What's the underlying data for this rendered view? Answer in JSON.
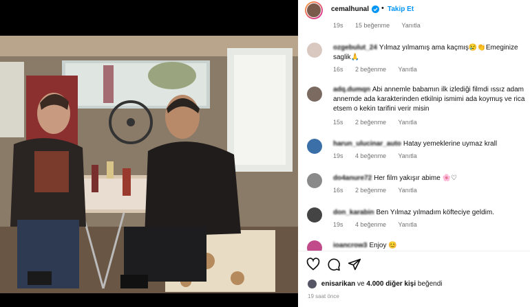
{
  "post": {
    "username": "cemalhunal",
    "follow_label": "Takip Et",
    "separator": "•"
  },
  "comments": [
    {
      "user": "",
      "text": "",
      "time": "19s",
      "likes": "15 beğenme",
      "reply": "Yanıtla"
    },
    {
      "user": "ozgebulut_24",
      "text": "Yılmaz yılmamış ama kaçmış😢👏Emeginize saglik🙏",
      "time": "16s",
      "likes": "2 beğenme",
      "reply": "Yanıtla"
    },
    {
      "user": "adq.dumqn",
      "text": "Abi annemle babamın ilk izlediği filmdi ıssız adam annemde ada karakterinden etkilnip ismimi ada koymuş ve rica etsem o kekin tarifini verir misin",
      "time": "15s",
      "likes": "2 beğenme",
      "reply": "Yanıtla"
    },
    {
      "user": "harun_ulucinar_auto",
      "text": "Hatay yemeklerine uymaz krall",
      "time": "19s",
      "likes": "4 beğenme",
      "reply": "Yanıtla"
    },
    {
      "user": "do4anure72",
      "text": "Her film yakışır abime 🌸♡",
      "time": "16s",
      "likes": "2 beğenme",
      "reply": "Yanıtla"
    },
    {
      "user": "don_karabin",
      "text": "Ben Yılmaz yılmadım köfteciye geldim.",
      "time": "19s",
      "likes": "4 beğenme",
      "reply": "Yanıtla"
    },
    {
      "user": "ioancrow3",
      "text": "Enjoy 😊",
      "time": "",
      "likes": "",
      "reply": ""
    }
  ],
  "likes": {
    "user": "enisarikan",
    "connector": "ve",
    "count_text": "4.000 diğer kişi",
    "suffix": "beğendi"
  },
  "time_ago": "19 saat önce",
  "icons": [
    "heart-icon",
    "comment-icon",
    "share-icon",
    "verified-icon"
  ],
  "colors": {
    "follow": "#0095f6",
    "verified": "#0095f6",
    "meta": "#737373"
  }
}
